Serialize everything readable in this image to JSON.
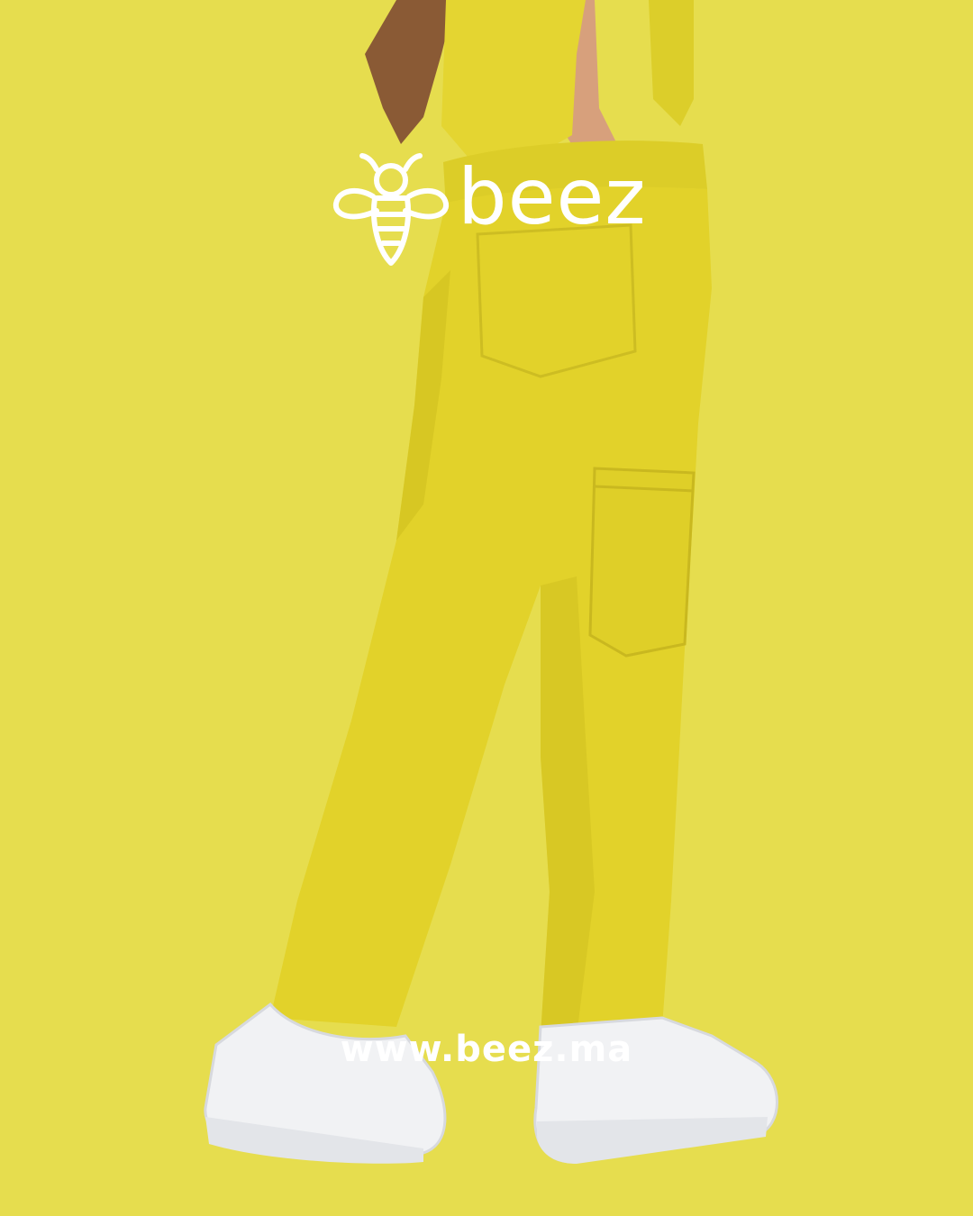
{
  "brand": {
    "wordmark": "beez",
    "logo_icon": "bee-icon",
    "url": "www.beez.ma"
  },
  "colors": {
    "background": "#e6dd4e",
    "garment": "#e2d22a",
    "logo_and_text": "#ffffff"
  }
}
